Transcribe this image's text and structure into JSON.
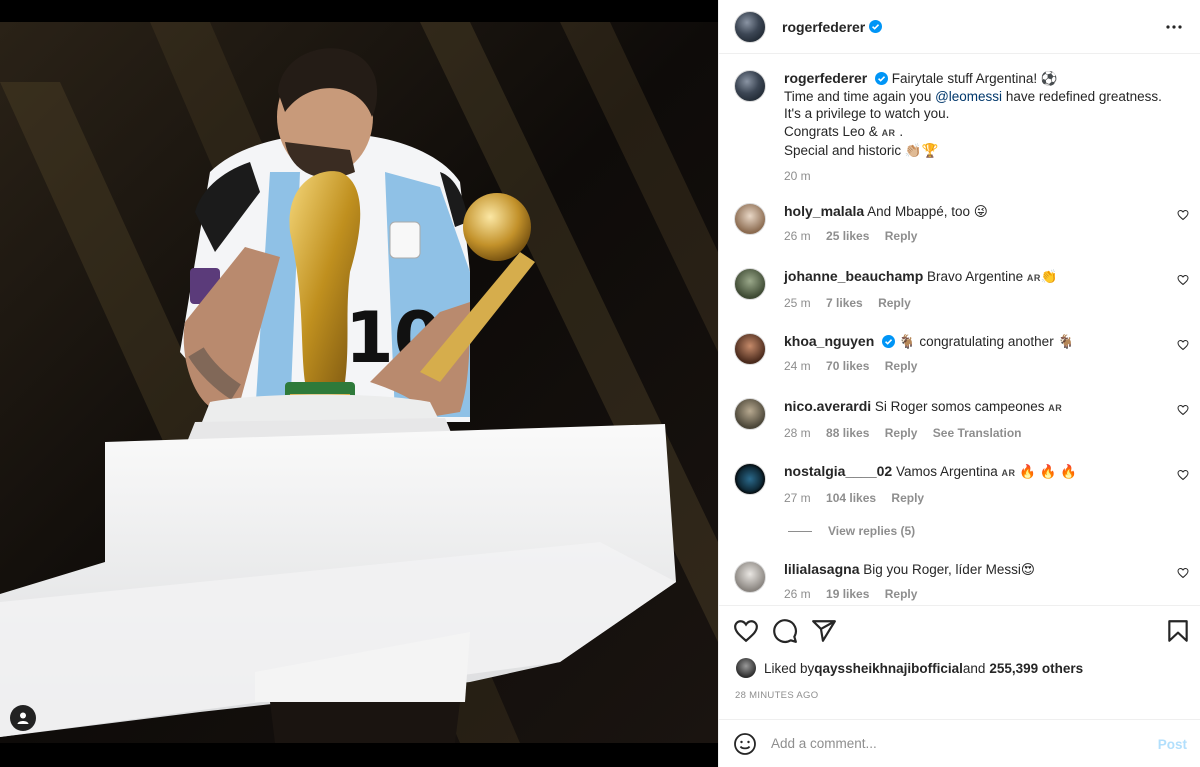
{
  "post": {
    "author": "rogerfederer",
    "verified": true,
    "caption_lines": [
      "Fairytale stuff Argentina! ⚽",
      "Time and time again you ",
      "@leomessi",
      " have redefined greatness.",
      "It's a privilege to watch you.",
      "Congrats Leo & ",
      "AR",
      " .",
      "Special and historic 👏🏼🏆"
    ],
    "caption_time": "20 m"
  },
  "comments": [
    {
      "user": "holy_malala",
      "text": "And Mbappé, too 😜",
      "time": "26 m",
      "likes": "25 likes",
      "reply": "Reply",
      "extra": ""
    },
    {
      "user": "johanne_beauchamp",
      "text": "Bravo Argentine ",
      "flag": "AR",
      "emoji": "👏",
      "time": "25 m",
      "likes": "7 likes",
      "reply": "Reply",
      "extra": ""
    },
    {
      "user": "khoa_nguyen",
      "verified": true,
      "text": "🐐 congratulating another 🐐",
      "time": "24 m",
      "likes": "70 likes",
      "reply": "Reply",
      "extra": ""
    },
    {
      "user": "nico.averardi",
      "text": "Si Roger somos campeones ",
      "flag": "AR",
      "time": "28 m",
      "likes": "88 likes",
      "reply": "Reply",
      "extra": "See Translation"
    },
    {
      "user": "nostalgia____02",
      "text": "Vamos Argentina ",
      "flag": "AR",
      "emoji": " 🔥 🔥 🔥",
      "time": "27 m",
      "likes": "104 likes",
      "reply": "Reply",
      "extra": ""
    },
    {
      "user": "lilialasagna",
      "text": "Big you Roger, líder Messi😍",
      "time": "26 m",
      "likes": "19 likes",
      "reply": "Reply",
      "extra": ""
    }
  ],
  "view_replies": "View replies (5)",
  "likes": {
    "prefix": "Liked by ",
    "user": "qayssheikhnajibofficial",
    "middle": " and ",
    "count": "255,399 others"
  },
  "posted_ago": "28 MINUTES AGO",
  "composer": {
    "placeholder": "Add a comment...",
    "post_label": "Post"
  },
  "icons": [
    "more-icon",
    "verified-badge-icon",
    "heart-icon",
    "comment-icon",
    "share-icon",
    "bookmark-icon",
    "emoji-icon",
    "user-tag-icon"
  ],
  "colors": {
    "verified": "#0095f6",
    "link": "#00376b",
    "muted": "#8e8e8e",
    "post_disabled": "#b2dffc"
  }
}
